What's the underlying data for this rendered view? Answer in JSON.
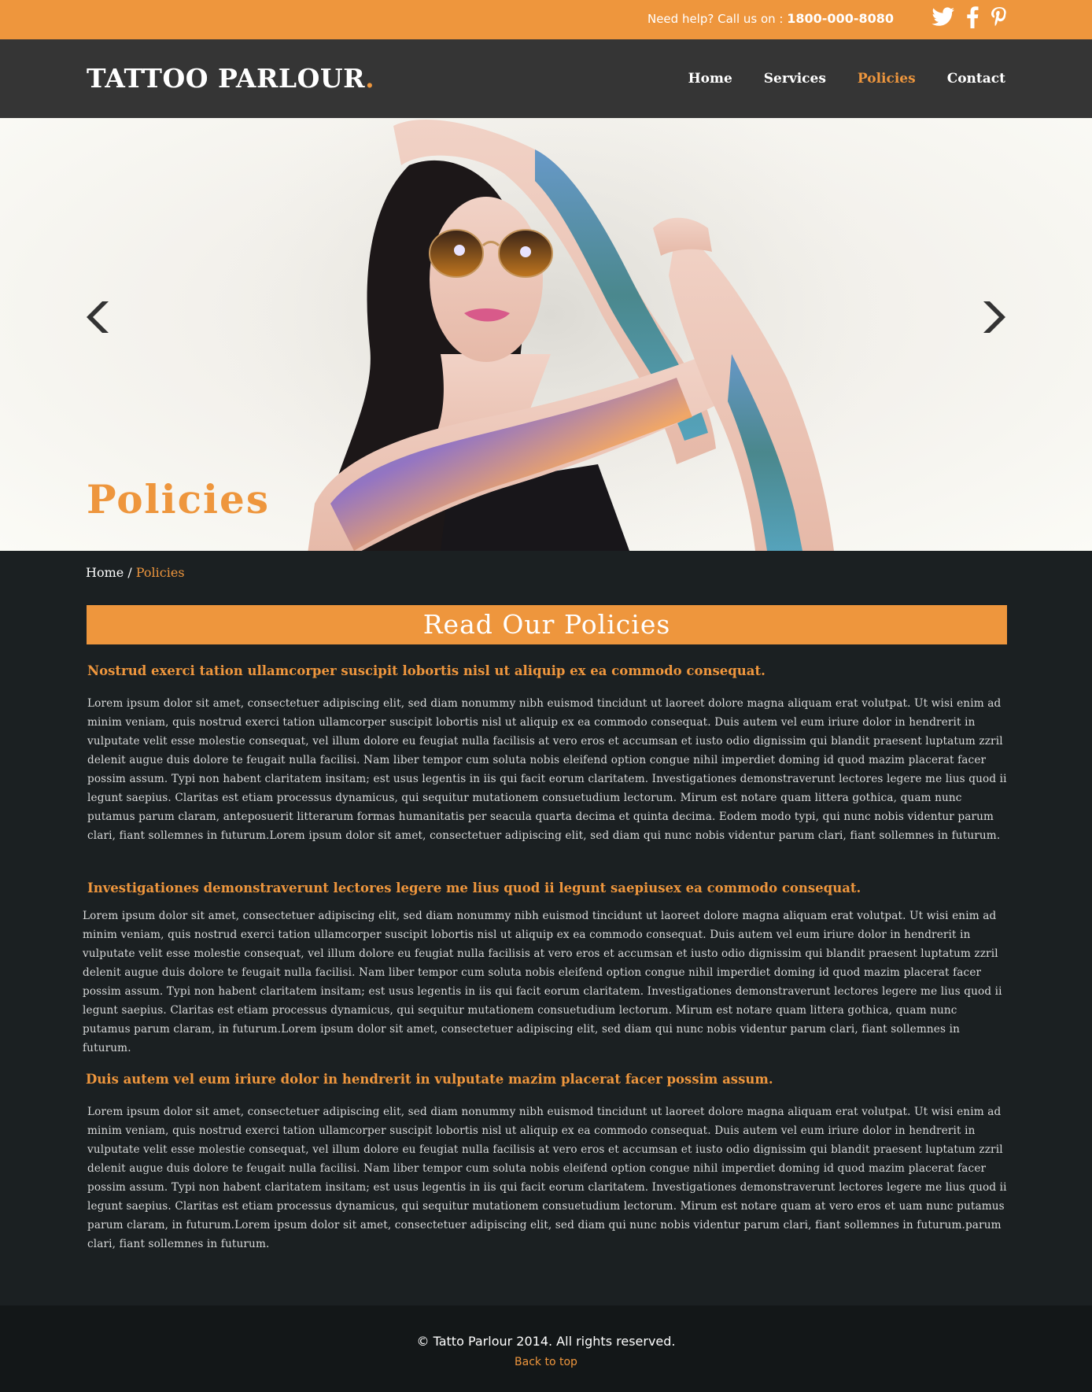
{
  "topbar": {
    "help_text": "Need help?  Call us on : ",
    "phone": "1800-000-8080",
    "social": [
      "twitter-icon",
      "facebook-icon",
      "pinterest-icon"
    ]
  },
  "header": {
    "logo": "TATTOO PARLOUR",
    "logo_dot": ".",
    "nav": [
      {
        "label": "Home",
        "active": false
      },
      {
        "label": "Services",
        "active": false
      },
      {
        "label": "Policies",
        "active": true
      },
      {
        "label": "Contact",
        "active": false
      }
    ]
  },
  "hero": {
    "title": "Policies",
    "prev_icon": "chevron-left-icon",
    "next_icon": "chevron-right-icon"
  },
  "breadcrumb": {
    "home": "Home",
    "separator": " / ",
    "current": "Policies"
  },
  "banner": {
    "title": "Read Our Policies"
  },
  "sections": [
    {
      "title": "Nostrud exerci tation ullamcorper suscipit lobortis nisl ut aliquip ex ea commodo consequat.",
      "body": "Lorem ipsum dolor sit amet, consectetuer adipiscing elit, sed diam nonummy nibh euismod tincidunt ut laoreet dolore magna aliquam erat volutpat. Ut wisi enim ad minim veniam, quis nostrud exerci tation ullamcorper suscipit lobortis nisl ut aliquip ex ea commodo consequat. Duis autem vel eum iriure dolor in hendrerit in vulputate velit esse molestie consequat, vel illum dolore eu feugiat nulla facilisis at vero eros et accumsan et iusto odio dignissim qui blandit praesent luptatum zzril delenit augue duis dolore te feugait nulla facilisi. Nam liber tempor cum soluta nobis eleifend option congue nihil imperdiet doming id quod mazim placerat facer possim assum. Typi non habent claritatem insitam; est usus legentis in iis qui facit eorum claritatem. Investigationes demonstraverunt lectores legere me lius quod ii legunt saepius. Claritas est etiam processus dynamicus, qui sequitur mutationem consuetudium lectorum. Mirum est notare quam littera gothica, quam nunc putamus parum claram, anteposuerit litterarum formas humanitatis per seacula quarta decima et quinta decima. Eodem modo typi, qui nunc nobis videntur parum clari, fiant sollemnes in futurum.Lorem ipsum dolor sit amet, consectetuer adipiscing elit, sed diam  qui nunc nobis videntur parum clari, fiant sollemnes in futurum."
    },
    {
      "title": "Investigationes demonstraverunt lectores legere me lius quod ii legunt saepiusex ea commodo consequat.",
      "body": "Lorem ipsum dolor sit amet, consectetuer adipiscing elit, sed diam nonummy nibh euismod tincidunt ut laoreet dolore magna aliquam erat volutpat. Ut wisi enim ad minim veniam, quis nostrud exerci tation ullamcorper suscipit lobortis nisl ut aliquip ex ea commodo consequat. Duis autem vel eum iriure dolor in hendrerit in vulputate velit esse molestie consequat, vel illum dolore eu feugiat nulla facilisis at vero eros et accumsan et iusto odio dignissim qui blandit praesent luptatum zzril delenit augue duis dolore te feugait nulla facilisi. Nam liber tempor cum soluta nobis eleifend option congue nihil imperdiet doming id quod mazim placerat facer possim assum. Typi non habent claritatem insitam; est usus legentis in iis qui facit eorum claritatem. Investigationes demonstraverunt lectores legere me lius quod ii legunt saepius. Claritas est etiam processus dynamicus, qui sequitur mutationem consuetudium lectorum. Mirum est notare quam littera gothica, quam nunc putamus parum claram, in futurum.Lorem ipsum dolor sit amet, consectetuer adipiscing elit, sed diam  qui nunc nobis videntur parum clari, fiant sollemnes in futurum."
    },
    {
      "title": "Duis autem vel eum iriure dolor in hendrerit in vulputate mazim placerat facer possim assum.",
      "body": "Lorem ipsum dolor sit amet, consectetuer adipiscing elit, sed diam nonummy nibh euismod tincidunt ut laoreet dolore magna aliquam erat volutpat. Ut wisi enim ad minim veniam, quis nostrud exerci tation ullamcorper suscipit lobortis nisl ut aliquip ex ea commodo consequat. Duis autem vel eum iriure dolor in hendrerit in vulputate velit esse molestie consequat, vel illum dolore eu feugiat nulla facilisis at vero eros et accumsan et iusto odio dignissim qui blandit praesent luptatum zzril delenit augue duis dolore te feugait nulla facilisi. Nam liber tempor cum soluta nobis eleifend option congue nihil imperdiet doming id quod mazim placerat facer possim assum. Typi non habent claritatem insitam; est usus legentis in iis qui facit eorum claritatem. Investigationes demonstraverunt lectores legere me lius quod ii legunt saepius. Claritas est etiam processus dynamicus, qui sequitur mutationem consuetudium lectorum. Mirum est notare quam at vero eros et uam nunc putamus parum claram, in futurum.Lorem ipsum dolor sit amet, consectetuer adipiscing elit, sed diam  qui nunc nobis videntur parum clari, fiant sollemnes in futurum.parum clari, fiant sollemnes in futurum."
    }
  ],
  "footer": {
    "copyright": "© Tatto Parlour 2014. All rights reserved.",
    "back_to_top": "Back to top"
  },
  "colors": {
    "accent": "#ee963d",
    "header_bg": "#353535",
    "page_bg": "#1b2022",
    "footer_bg": "#131718"
  }
}
